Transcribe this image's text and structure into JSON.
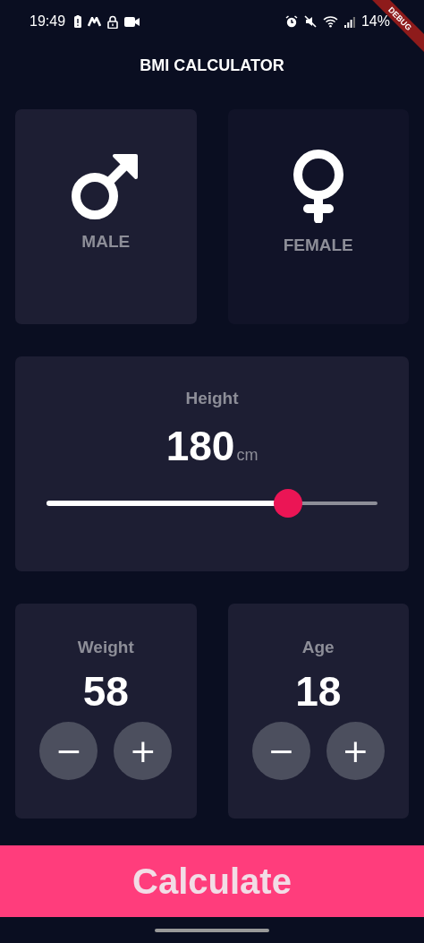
{
  "status_bar": {
    "time": "19:49",
    "battery": "14%"
  },
  "debug_banner": "DEBUG",
  "title": "BMI CALCULATOR",
  "genders": [
    {
      "kind": "male",
      "label": "MALE",
      "selected": true
    },
    {
      "kind": "female",
      "label": "FEMALE",
      "selected": false
    }
  ],
  "height": {
    "label": "Height",
    "value": "180",
    "unit": "cm",
    "level": 0.73
  },
  "counters": [
    {
      "label": "Weight",
      "value": "58",
      "minus": "−",
      "plus": "+"
    },
    {
      "label": "Age",
      "value": "18",
      "minus": "−",
      "plus": "+"
    }
  ],
  "calculate_button": "Calculate"
}
